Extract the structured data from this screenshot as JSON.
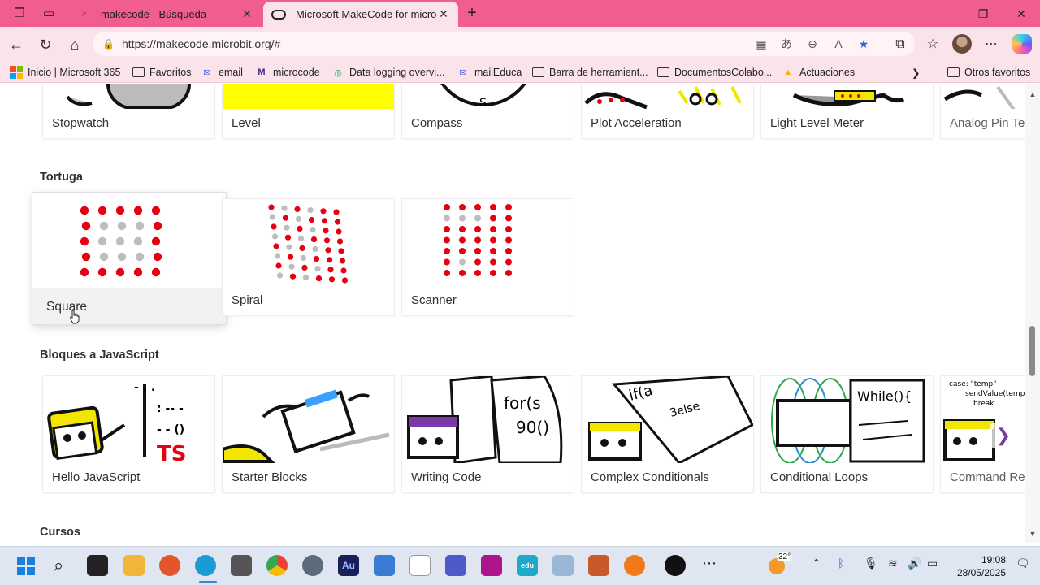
{
  "browser": {
    "tabs": [
      {
        "label": "makecode - Búsqueda",
        "active": false
      },
      {
        "label": "Microsoft MakeCode for micro:bit",
        "active": true
      }
    ],
    "url": "https://makecode.microbit.org/#"
  },
  "favorites": [
    {
      "label": "Inicio | Microsoft 365",
      "icon": "microsoft-logo-icon"
    },
    {
      "label": "Favoritos",
      "icon": "folder-icon"
    },
    {
      "label": "email",
      "icon": "mail-icon"
    },
    {
      "label": "microcode",
      "icon": "m-logo-icon"
    },
    {
      "label": "Data logging overvi...",
      "icon": "globe-icon"
    },
    {
      "label": "mailEduca",
      "icon": "mail-icon"
    },
    {
      "label": "Barra de herramient...",
      "icon": "folder-icon"
    },
    {
      "label": "DocumentosColabo...",
      "icon": "folder-icon"
    },
    {
      "label": "Actuaciones",
      "icon": "google-drive-icon"
    },
    {
      "label": "Otros favoritos",
      "icon": "folder-icon"
    }
  ],
  "sections": {
    "top_row": [
      "Stopwatch",
      "Level",
      "Compass",
      "Plot Acceleration",
      "Light Level Meter",
      "Analog Pin Te"
    ],
    "tortuga": {
      "title": "Tortuga",
      "cards": [
        "Square",
        "Spiral",
        "Scanner"
      ]
    },
    "javascript": {
      "title": "Bloques a JavaScript",
      "cards": [
        "Hello JavaScript",
        "Starter Blocks",
        "Writing Code",
        "Complex Conditionals",
        "Conditional Loops",
        "Command Re"
      ]
    },
    "cursos": {
      "title": "Cursos"
    }
  },
  "taskbar": {
    "weather_temp": "32°",
    "time": "19:08",
    "date": "28/05/2025",
    "colors": {
      "accent": "#1b7fe0",
      "tab_bar": "#f05d8e",
      "toolbar": "#fbe3ea",
      "dot_red": "#e60012",
      "dot_grey": "#bdbdbd"
    }
  }
}
